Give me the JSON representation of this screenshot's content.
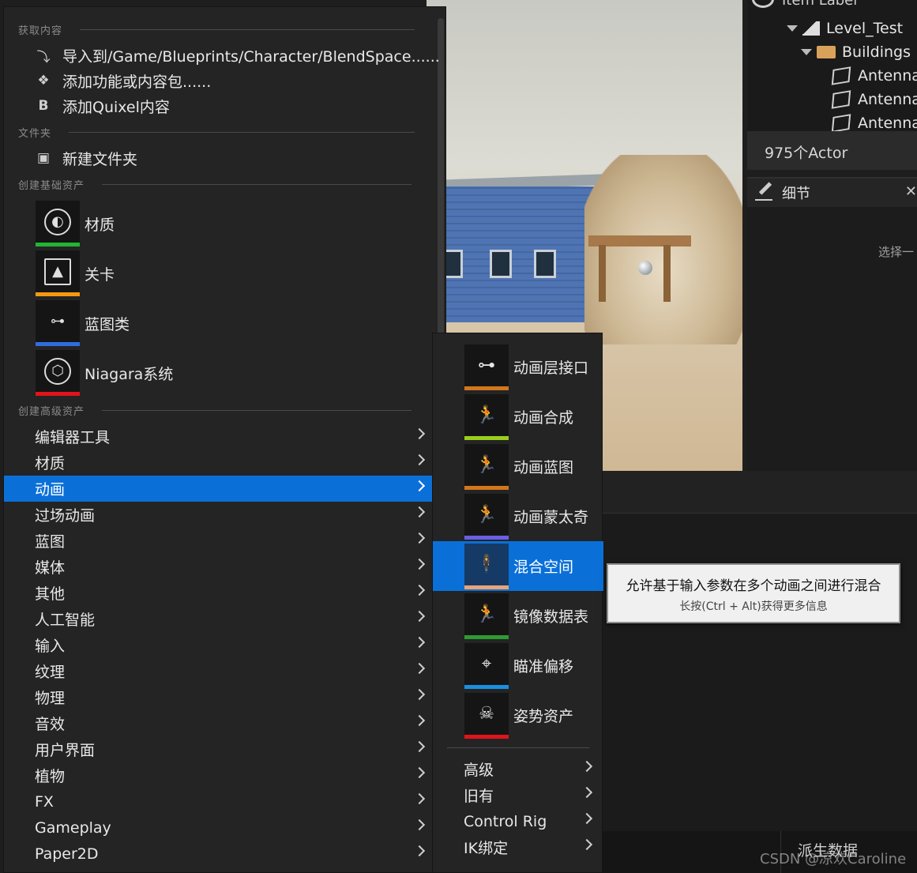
{
  "outliner": {
    "header": "Item Label",
    "tree": [
      {
        "label": "Level_Test",
        "icon": "level-icon"
      },
      {
        "label": "Buildings",
        "icon": "folder-icon"
      },
      {
        "label": "Antenna",
        "icon": "static-mesh-icon"
      },
      {
        "label": "Antenna",
        "icon": "static-mesh-icon"
      },
      {
        "label": "Antenna",
        "icon": "static-mesh-icon"
      }
    ],
    "actor_count": "975个Actor"
  },
  "details": {
    "title": "细节",
    "hint": "选择一"
  },
  "bottom": {
    "derived_data": "派生数据"
  },
  "watermark": "CSDN @凉欢Caroline",
  "menu": {
    "sections": {
      "get_content": "获取内容",
      "folder": "文件夹",
      "basic_assets": "创建基础资产",
      "advanced_assets": "创建高级资产"
    },
    "get_content_items": [
      {
        "label": "导入到/Game/Blueprints/Character/BlendSpace......",
        "icon": "import-icon"
      },
      {
        "label": "添加功能或内容包......",
        "icon": "feature-pack-icon"
      },
      {
        "label": "添加Quixel内容",
        "icon": "quixel-icon"
      }
    ],
    "folder_items": [
      {
        "label": "新建文件夹",
        "icon": "new-folder-icon"
      }
    ],
    "basic_assets": [
      {
        "label": "材质",
        "icon": "material-icon",
        "stripe": "#21b533"
      },
      {
        "label": "关卡",
        "icon": "level-icon",
        "stripe": "#f59a10"
      },
      {
        "label": "蓝图类",
        "icon": "blueprint-icon",
        "stripe": "#2f6de0"
      },
      {
        "label": "Niagara系统",
        "icon": "niagara-icon",
        "stripe": "#e0141a"
      }
    ],
    "categories": [
      "编辑器工具",
      "材质",
      "动画",
      "过场动画",
      "蓝图",
      "媒体",
      "其他",
      "人工智能",
      "输入",
      "纹理",
      "物理",
      "音效",
      "用户界面",
      "植物",
      "FX",
      "Gameplay",
      "Paper2D"
    ],
    "selected_category": "动画"
  },
  "submenu": {
    "items": [
      {
        "label": "动画层接口",
        "icon": "anim-layer-interface-icon",
        "stripe": "#d0761c"
      },
      {
        "label": "动画合成",
        "icon": "anim-composite-icon",
        "stripe": "#9acd1e"
      },
      {
        "label": "动画蓝图",
        "icon": "anim-blueprint-icon",
        "stripe": "#d0761c"
      },
      {
        "label": "动画蒙太奇",
        "icon": "anim-montage-icon",
        "stripe": "#6a5fe0"
      },
      {
        "label": "混合空间",
        "icon": "blend-space-icon",
        "stripe": "#e8a37a"
      },
      {
        "label": "镜像数据表",
        "icon": "mirror-table-icon",
        "stripe": "#2e9b32"
      },
      {
        "label": "瞄准偏移",
        "icon": "aim-offset-icon",
        "stripe": "#1a8fe0"
      },
      {
        "label": "姿势资产",
        "icon": "pose-asset-icon",
        "stripe": "#e0141a"
      }
    ],
    "selected_item": "混合空间",
    "categories": [
      "高级",
      "旧有",
      "Control Rig",
      "IK绑定"
    ]
  },
  "tooltip": {
    "title": "允许基于输入参数在多个动画之间进行混合",
    "hint": "长按(Ctrl + Alt)获得更多信息"
  },
  "colors": {
    "selection": "#0a70d8",
    "menu_bg": "#242424",
    "tooltip_bg": "#f0f0f0"
  }
}
